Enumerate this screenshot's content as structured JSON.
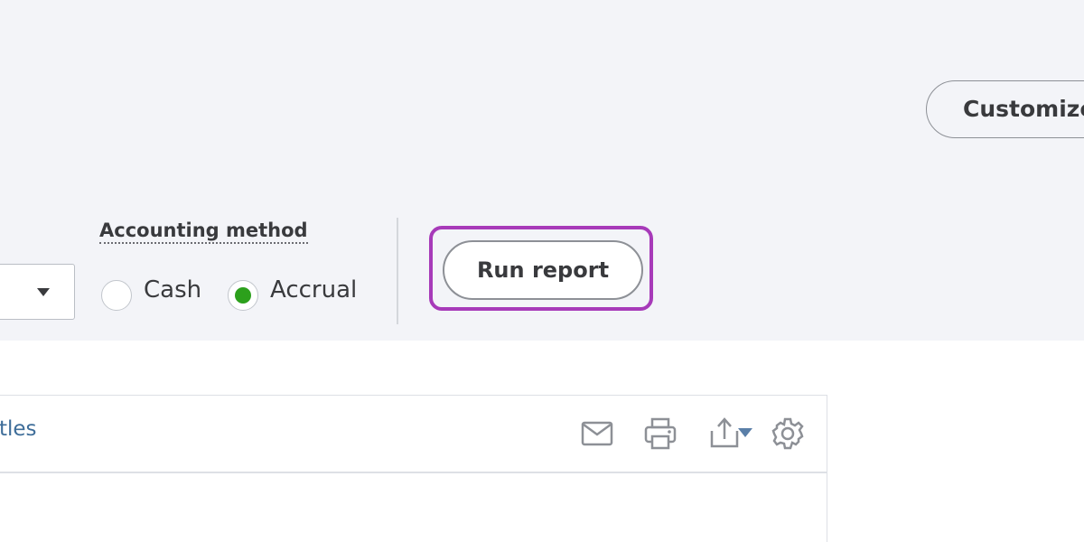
{
  "header": {
    "customize_label": "Customize"
  },
  "filters": {
    "accounting_method": {
      "label": "Accounting method",
      "options": [
        {
          "label": "Cash",
          "selected": false
        },
        {
          "label": "Accrual",
          "selected": true
        }
      ]
    },
    "run_report_label": "Run report"
  },
  "report": {
    "link_text": "tles",
    "toolbar_icons": [
      "email-icon",
      "print-icon",
      "export-icon",
      "settings-icon"
    ]
  },
  "colors": {
    "accent_highlight": "#a73ab9",
    "selected_radio": "#2ca01c",
    "link": "#3e6d99"
  }
}
